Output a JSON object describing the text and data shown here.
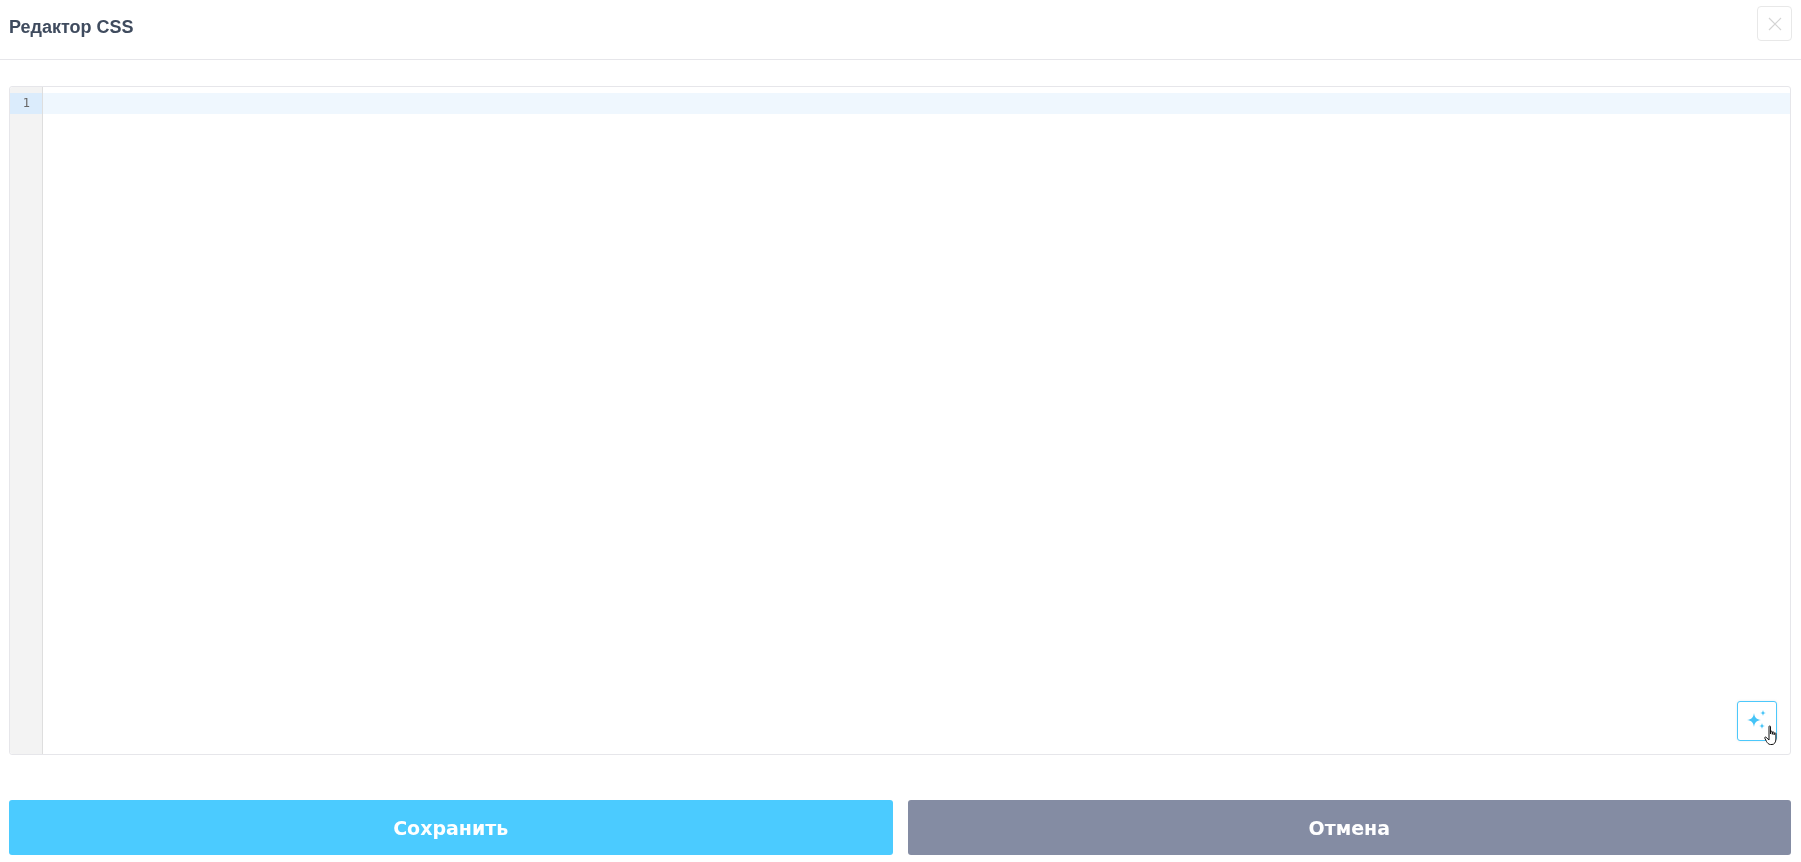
{
  "dialog": {
    "title": "Редактор CSS"
  },
  "editor": {
    "lines": [
      {
        "number": "1",
        "active": true
      }
    ]
  },
  "buttons": [
    {
      "label": "Сохранить",
      "kind": "primary"
    },
    {
      "label": "Отмена",
      "kind": "secondary"
    }
  ]
}
